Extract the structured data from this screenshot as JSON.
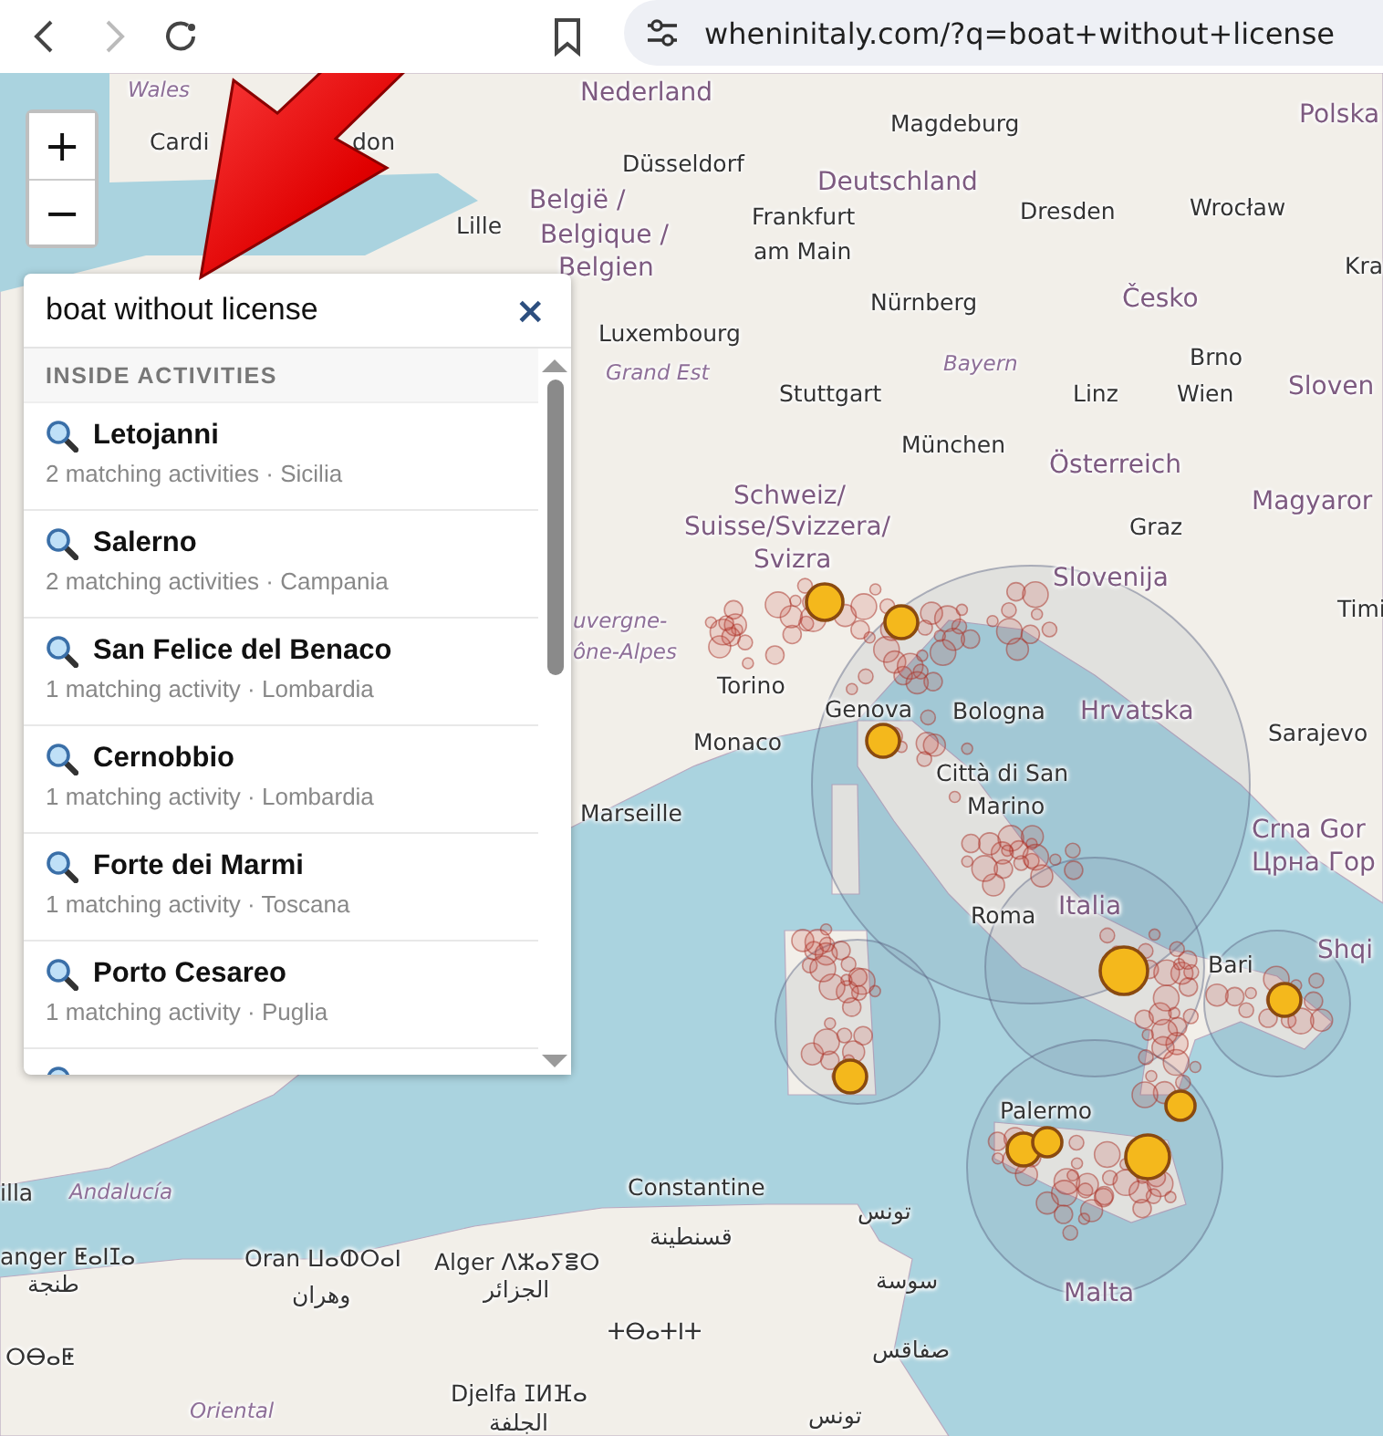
{
  "browser": {
    "url": "wheninitaly.com/?q=boat+without+license"
  },
  "map": {
    "zoom_in": "+",
    "zoom_out": "−",
    "labels": [
      {
        "text": "Wales",
        "kind": "region"
      },
      {
        "text": "Cardi",
        "kind": "city"
      },
      {
        "text": "don",
        "kind": "city"
      },
      {
        "text": "Nederland",
        "kind": "country"
      },
      {
        "text": "Magdeburg",
        "kind": "city"
      },
      {
        "text": "Düsseldorf",
        "kind": "city"
      },
      {
        "text": "Deutschland",
        "kind": "country"
      },
      {
        "text": "Dresden",
        "kind": "city"
      },
      {
        "text": "Wrocław",
        "kind": "city"
      },
      {
        "text": "Polska",
        "kind": "country"
      },
      {
        "text": "Lille",
        "kind": "city"
      },
      {
        "text": "België /",
        "kind": "country"
      },
      {
        "text": "Belgique /",
        "kind": "country"
      },
      {
        "text": "Belgien",
        "kind": "country"
      },
      {
        "text": "Frankfurt",
        "kind": "city"
      },
      {
        "text": "am Main",
        "kind": "city"
      },
      {
        "text": "Kra",
        "kind": "city"
      },
      {
        "text": "Česko",
        "kind": "country"
      },
      {
        "text": "Nürnberg",
        "kind": "city"
      },
      {
        "text": "Luxembourg",
        "kind": "city"
      },
      {
        "text": "Grand Est",
        "kind": "region"
      },
      {
        "text": "Bayern",
        "kind": "region"
      },
      {
        "text": "Brno",
        "kind": "city"
      },
      {
        "text": "Sloven",
        "kind": "country"
      },
      {
        "text": "Stuttgart",
        "kind": "city"
      },
      {
        "text": "Linz",
        "kind": "city"
      },
      {
        "text": "Wien",
        "kind": "city"
      },
      {
        "text": "München",
        "kind": "city"
      },
      {
        "text": "Österreich",
        "kind": "country"
      },
      {
        "text": "Schweiz/",
        "kind": "country"
      },
      {
        "text": "Suisse/Svizzera/",
        "kind": "country"
      },
      {
        "text": "Svizra",
        "kind": "country"
      },
      {
        "text": "Magyaror",
        "kind": "country"
      },
      {
        "text": "Graz",
        "kind": "city"
      },
      {
        "text": "Slovenija",
        "kind": "country"
      },
      {
        "text": "Timi",
        "kind": "city"
      },
      {
        "text": "uvergne-",
        "kind": "region"
      },
      {
        "text": "ône-Alpes",
        "kind": "region"
      },
      {
        "text": "Torino",
        "kind": "city"
      },
      {
        "text": "Genova",
        "kind": "city"
      },
      {
        "text": "Bologna",
        "kind": "city"
      },
      {
        "text": "Hrvatska",
        "kind": "country"
      },
      {
        "text": "Sarajevo",
        "kind": "city"
      },
      {
        "text": "Monaco",
        "kind": "city"
      },
      {
        "text": "Città di San",
        "kind": "city"
      },
      {
        "text": "Marino",
        "kind": "city"
      },
      {
        "text": "Marseille",
        "kind": "city"
      },
      {
        "text": "Crna Gor",
        "kind": "country"
      },
      {
        "text": "Црна Гор",
        "kind": "country"
      },
      {
        "text": "Roma",
        "kind": "city"
      },
      {
        "text": "Italia",
        "kind": "country"
      },
      {
        "text": "Bari",
        "kind": "city"
      },
      {
        "text": "Shqi",
        "kind": "country"
      },
      {
        "text": "Palermo",
        "kind": "city"
      },
      {
        "text": "Constantine",
        "kind": "city"
      },
      {
        "text": "قسنطينة",
        "kind": "city"
      },
      {
        "text": "Malta",
        "kind": "country"
      },
      {
        "text": "illa",
        "kind": "city"
      },
      {
        "text": "Andalucía",
        "kind": "region"
      },
      {
        "text": "anger ⵟⴰⵏⵊⴰ",
        "kind": "city"
      },
      {
        "text": "طنجة",
        "kind": "city"
      },
      {
        "text": "Oran ⵡⴰⵀⵔⴰⵏ",
        "kind": "city"
      },
      {
        "text": "وهران",
        "kind": "city"
      },
      {
        "text": "Alger ⴷⵣⴰⵢⴻⵔ",
        "kind": "city"
      },
      {
        "text": "الجزائر",
        "kind": "city"
      },
      {
        "text": "ⵔⴱⴰⵟ",
        "kind": "city"
      },
      {
        "text": "ⵜⴱⴰⵜⵏⵜ",
        "kind": "city"
      },
      {
        "text": "تونس",
        "kind": "city"
      },
      {
        "text": "سوسة",
        "kind": "city"
      },
      {
        "text": "صفاقس",
        "kind": "city"
      },
      {
        "text": "Djelfa ⵊⵍⴼⴰ",
        "kind": "city"
      },
      {
        "text": "الجلفة",
        "kind": "city"
      },
      {
        "text": "Oriental",
        "kind": "region"
      },
      {
        "text": "تونس",
        "kind": "city"
      }
    ]
  },
  "search": {
    "value": "boat without license",
    "clear": "×",
    "section": "INSIDE ACTIVITIES",
    "results": [
      {
        "title": "Letojanni",
        "detail": "2 matching activities · Sicilia"
      },
      {
        "title": "Salerno",
        "detail": "2 matching activities · Campania"
      },
      {
        "title": "San Felice del Benaco",
        "detail": "1 matching activity · Lombardia"
      },
      {
        "title": "Cernobbio",
        "detail": "1 matching activity · Lombardia"
      },
      {
        "title": "Forte dei Marmi",
        "detail": "1 matching activity · Toscana"
      },
      {
        "title": "Porto Cesareo",
        "detail": "1 matching activity · Puglia"
      }
    ]
  }
}
